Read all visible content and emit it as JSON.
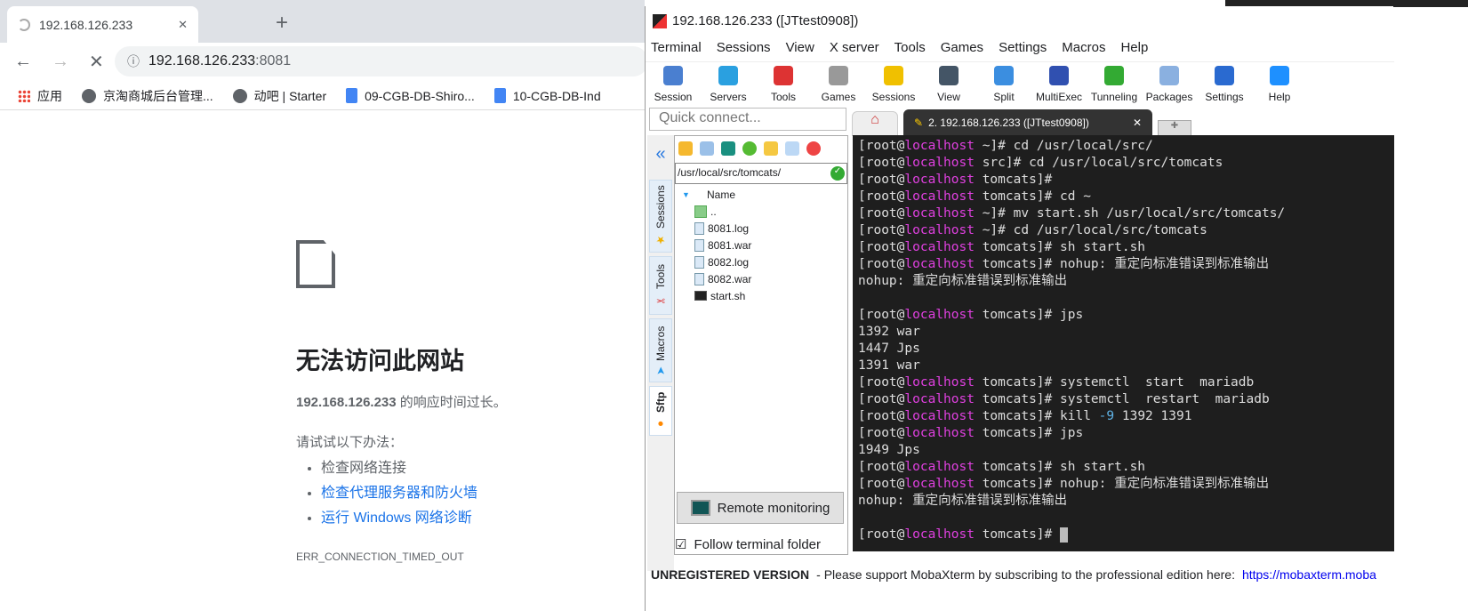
{
  "browser": {
    "tab_title": "192.168.126.233",
    "url_host": "192.168.126.233",
    "url_port": ":8081",
    "bookmarks": [
      "应用",
      "京淘商城后台管理...",
      "动吧 | Starter",
      "09-CGB-DB-Shiro...",
      "10-CGB-DB-Ind"
    ],
    "error": {
      "heading": "无法访问此网站",
      "host": "192.168.126.233",
      "message": " 的响应时间过长。",
      "try": "请试试以下办法：",
      "suggestions": [
        "检查网络连接",
        "检查代理服务器和防火墙",
        "运行 Windows 网络诊断"
      ],
      "code": "ERR_CONNECTION_TIMED_OUT"
    }
  },
  "moba": {
    "title": "192.168.126.233 ([JTtest0908])",
    "menu": [
      "Terminal",
      "Sessions",
      "View",
      "X server",
      "Tools",
      "Games",
      "Settings",
      "Macros",
      "Help"
    ],
    "toolbar": [
      {
        "label": "Session",
        "color": "#4a7fd0"
      },
      {
        "label": "Servers",
        "color": "#2aa0e0"
      },
      {
        "label": "Tools",
        "color": "#d33"
      },
      {
        "label": "Games",
        "color": "#999"
      },
      {
        "label": "Sessions",
        "color": "#f0c000"
      },
      {
        "label": "View",
        "color": "#456"
      },
      {
        "label": "Split",
        "color": "#3b8ee0"
      },
      {
        "label": "MultiExec",
        "color": "#3050b0"
      },
      {
        "label": "Tunneling",
        "color": "#3a3"
      },
      {
        "label": "Packages",
        "color": "#8ab0e0"
      },
      {
        "label": "Settings",
        "color": "#2a6ad0"
      },
      {
        "label": "Help",
        "color": "#1e90ff"
      }
    ],
    "quick_connect_placeholder": "Quick connect...",
    "terminal_tab": "2. 192.168.126.233 ([JTtest0908])",
    "side_tabs": [
      "Sessions",
      "Tools",
      "Macros",
      "Sftp"
    ],
    "sftp": {
      "path": "/usr/local/src/tomcats/",
      "column": "Name",
      "files": [
        "..",
        "8081.log",
        "8081.war",
        "8082.log",
        "8082.war",
        "start.sh"
      ],
      "remote_monitoring": "Remote monitoring",
      "follow_folder": "Follow terminal folder"
    },
    "terminal_lines": [
      {
        "dir": "~",
        "cmd": "cd /usr/local/src/"
      },
      {
        "dir": "src",
        "cmd": "cd /usr/local/src/tomcats"
      },
      {
        "dir": "tomcats",
        "cmd": ""
      },
      {
        "dir": "tomcats",
        "cmd": "cd ~"
      },
      {
        "dir": "~",
        "cmd": "mv start.sh /usr/local/src/tomcats/"
      },
      {
        "dir": "~",
        "cmd": "cd /usr/local/src/tomcats"
      },
      {
        "dir": "tomcats",
        "cmd": "sh start.sh"
      },
      {
        "dir": "tomcats",
        "cmd": "nohup: 重定向标准错误到标准输出"
      },
      {
        "text": "nohup: 重定向标准错误到标准输出"
      },
      {
        "text": ""
      },
      {
        "dir": "tomcats",
        "cmd": "jps"
      },
      {
        "text": "1392 war"
      },
      {
        "text": "1447 Jps"
      },
      {
        "text": "1391 war"
      },
      {
        "dir": "tomcats",
        "cmd": "systemctl  start  mariadb"
      },
      {
        "dir": "tomcats",
        "cmd": "systemctl  restart  mariadb"
      },
      {
        "dir": "tomcats",
        "cmd": "kill ",
        "num": "-9",
        "rest": " 1392 1391"
      },
      {
        "dir": "tomcats",
        "cmd": "jps"
      },
      {
        "text": "1949 Jps"
      },
      {
        "dir": "tomcats",
        "cmd": "sh start.sh"
      },
      {
        "dir": "tomcats",
        "cmd": "nohup: 重定向标准错误到标准输出"
      },
      {
        "text": "nohup: 重定向标准错误到标准输出"
      },
      {
        "text": ""
      },
      {
        "dir": "tomcats",
        "cmd": "",
        "cursor": true
      }
    ],
    "prompt_user": "root",
    "prompt_host": "localhost",
    "status": {
      "bold": "UNREGISTERED VERSION",
      "text": " -  Please support MobaXterm by subscribing to the professional edition here:",
      "link": "https://mobaxterm.moba"
    }
  }
}
